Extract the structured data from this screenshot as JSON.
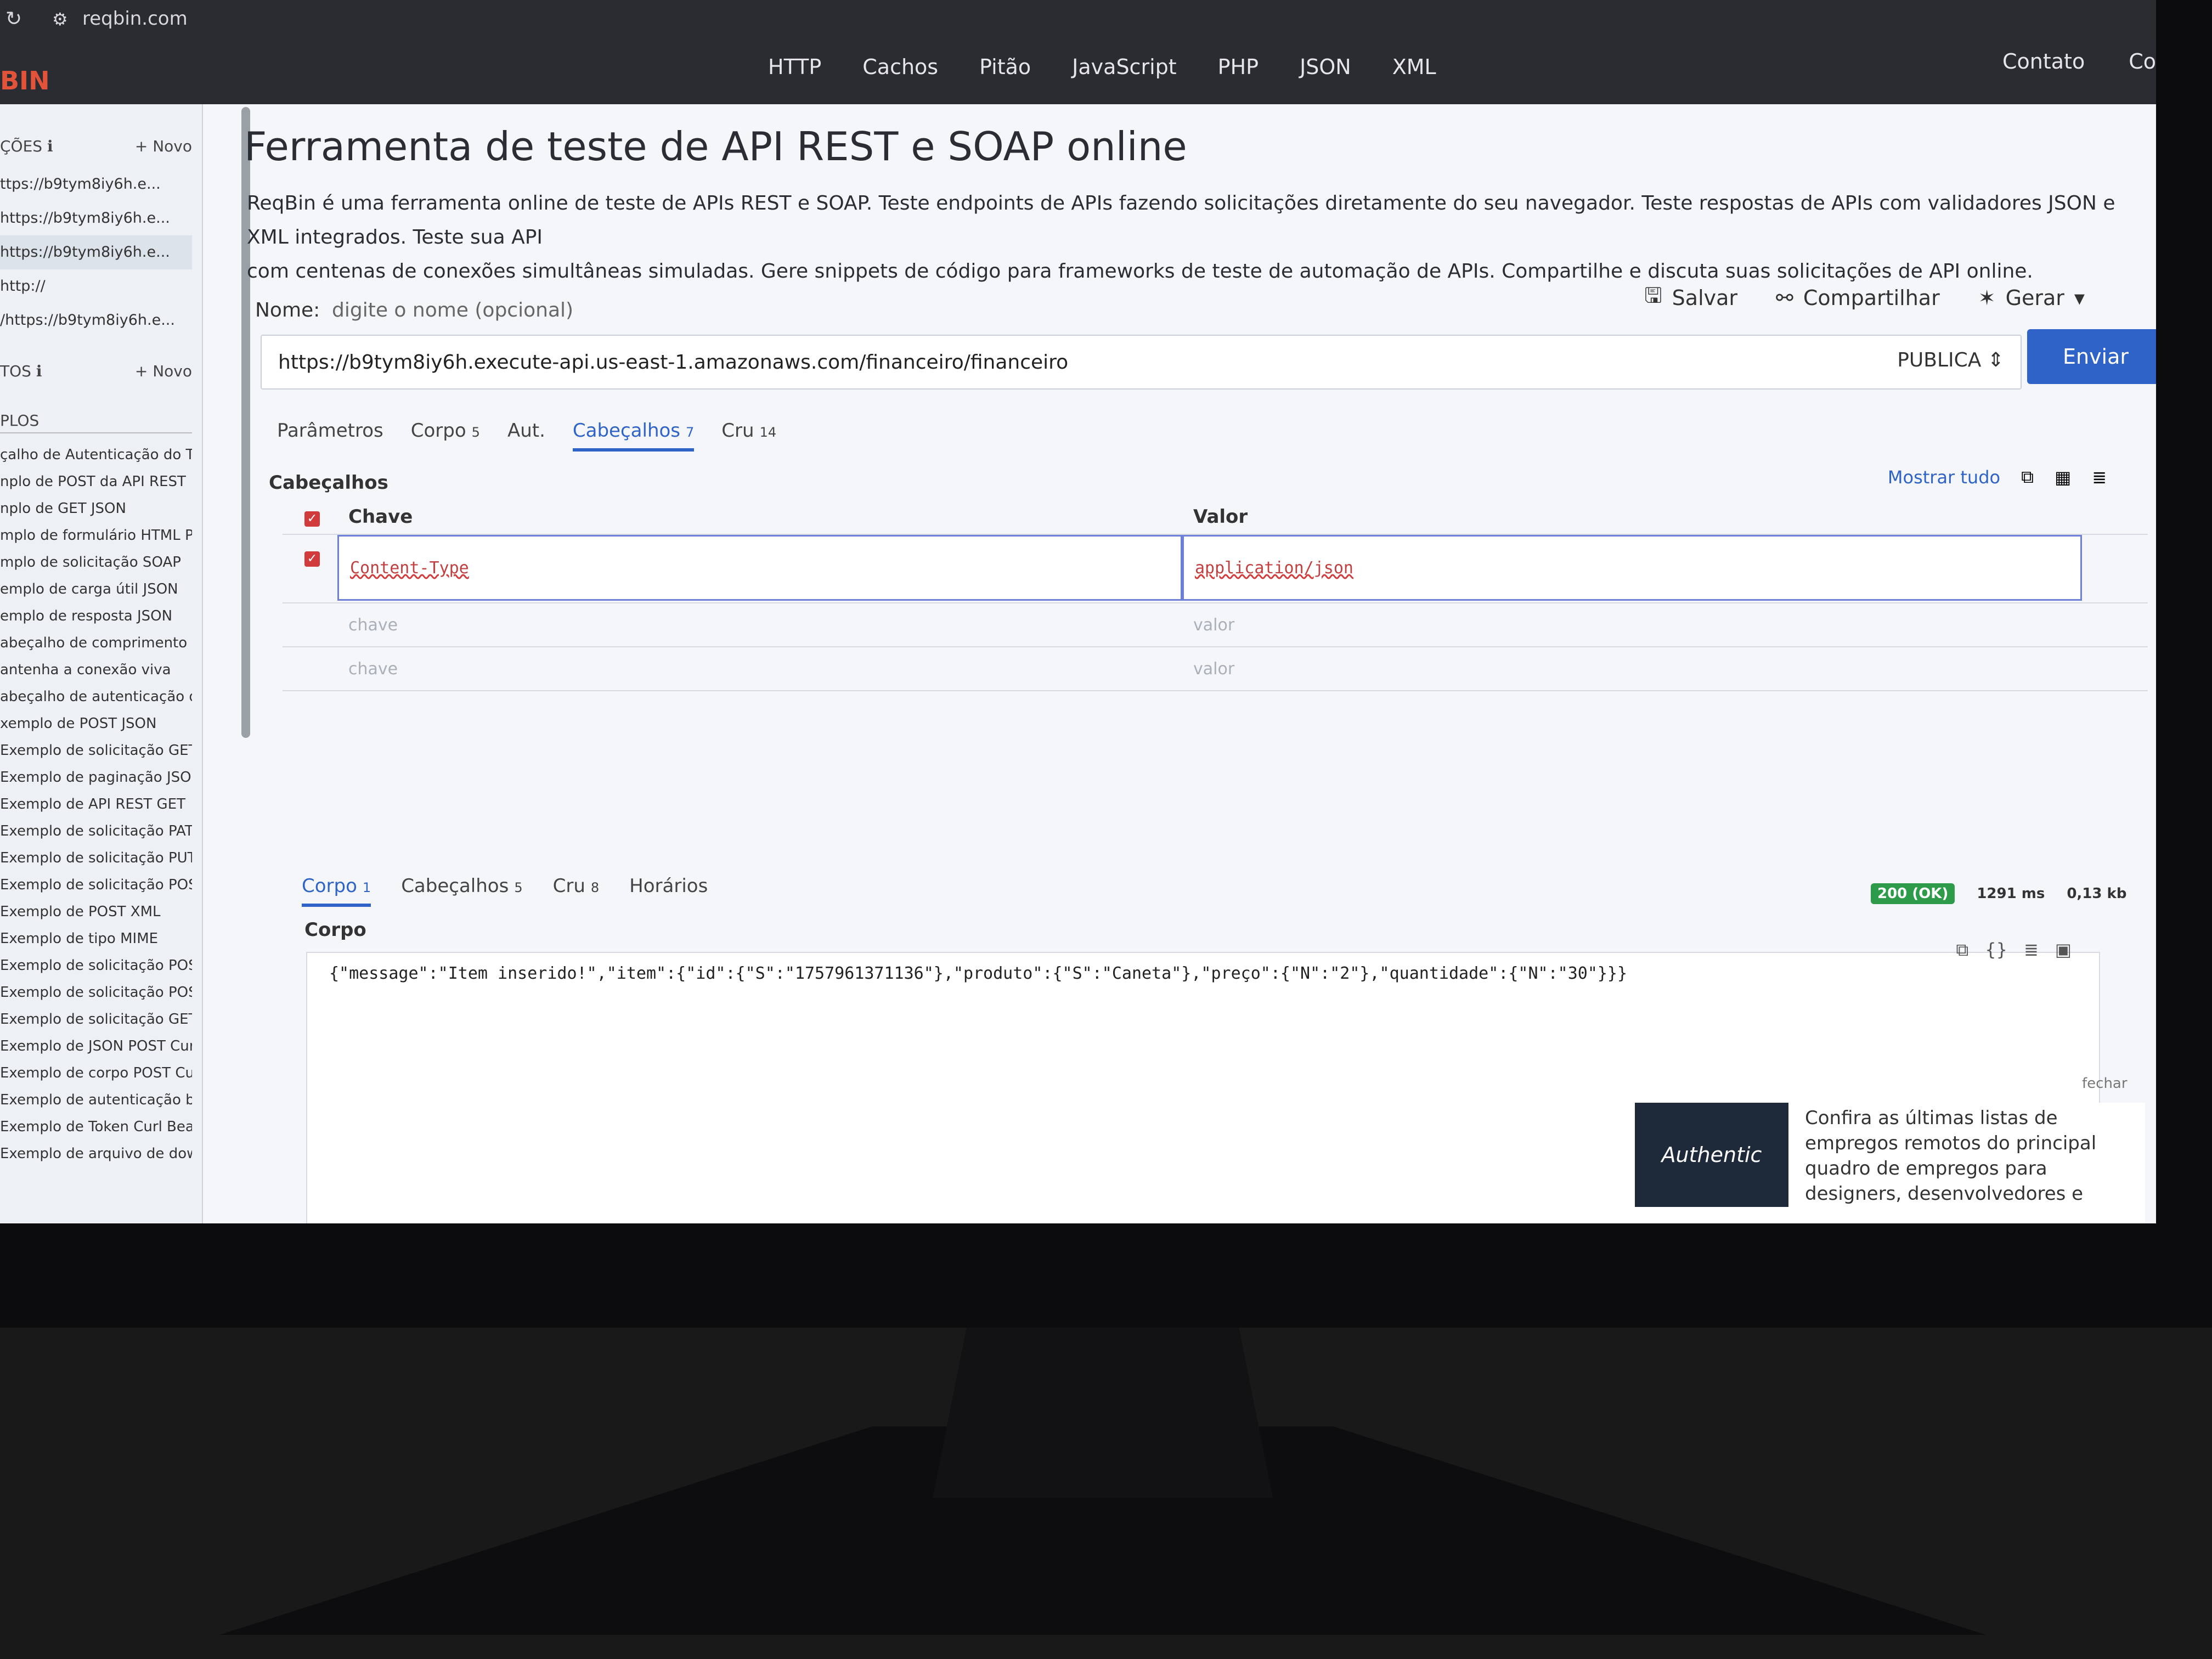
{
  "browser": {
    "url": "reqbin.com"
  },
  "nav": {
    "logo": "BIN",
    "links": [
      "HTTP",
      "Cachos",
      "Pitão",
      "JavaScript",
      "PHP",
      "JSON",
      "XML"
    ],
    "right": [
      "Contato",
      "Co"
    ]
  },
  "sidebar": {
    "collections_head": "ÇÕES ℹ",
    "new1": "+ Novo",
    "history": [
      "ttps://b9tym8iy6h.e...",
      "https://b9tym8iy6h.e...",
      "https://b9tym8iy6h.e...",
      "http://",
      "/https://b9tym8iy6h.e..."
    ],
    "saved_head": "TOS ℹ",
    "new2": "+ Novo",
    "examples_head": "PLOS",
    "examples": [
      "çalho de Autenticação do Toke",
      "nplo de POST da API REST",
      "nplo de GET JSON",
      "mplo de formulário HTML POST",
      "mplo de solicitação SOAP",
      "emplo de carga útil JSON",
      "emplo de resposta JSON",
      "abeçalho de comprimento de con",
      "antenha a conexão viva",
      "abeçalho de autenticação do toke",
      "xemplo de POST JSON",
      "Exemplo de solicitação GET",
      "Exemplo de paginação JSON",
      "Exemplo de API REST GET",
      "Exemplo de solicitação PATCH",
      "Exemplo de solicitação PUT",
      "Exemplo de solicitação POST",
      "Exemplo de POST XML",
      "Exemplo de tipo MIME",
      "Exemplo de solicitação POST da AP",
      "Exemplo de solicitação POST Curl",
      "Exemplo de solicitação GET Curl",
      "Exemplo de JSON POST Curl",
      "Exemplo de corpo POST Curl",
      "Exemplo de autenticação básica Cu",
      "Exemplo de Token Curl Bearer",
      "Exemplo de arquivo de download d"
    ]
  },
  "page": {
    "title": "Ferramenta de teste de API REST e SOAP online",
    "desc1": "ReqBin é uma ferramenta online de teste de APIs REST e SOAP. Teste endpoints de APIs fazendo solicitações diretamente do seu navegador. Teste respostas de APIs com validadores JSON e XML integrados. Teste sua API",
    "desc2": "com centenas de conexões simultâneas simuladas. Gere snippets de código para frameworks de teste de automação de APIs. Compartilhe e discuta suas solicitações de API online."
  },
  "request": {
    "name_label": "Nome:",
    "name_placeholder": "digite o nome (opcional)",
    "save": "Salvar",
    "share": "Compartilhar",
    "generate": "Gerar",
    "url": "https://b9tym8iy6h.execute-api.us-east-1.amazonaws.com/financeiro/financeiro",
    "method": "PUBLICA ⇕",
    "send": "Enviar",
    "tabs": [
      {
        "label": "Parâmetros",
        "count": ""
      },
      {
        "label": "Corpo",
        "count": "5"
      },
      {
        "label": "Aut.",
        "count": ""
      },
      {
        "label": "Cabeçalhos",
        "count": "7"
      },
      {
        "label": "Cru",
        "count": "14"
      }
    ],
    "headers_title": "Cabeçalhos",
    "show_all": "Mostrar tudo",
    "col_key": "Chave",
    "col_value": "Valor",
    "header_key": "Content-Type",
    "header_value": "application/json",
    "key_placeholder": "chave",
    "value_placeholder": "valor"
  },
  "response": {
    "tabs": [
      {
        "label": "Corpo",
        "count": "1"
      },
      {
        "label": "Cabeçalhos",
        "count": "5"
      },
      {
        "label": "Cru",
        "count": "8"
      },
      {
        "label": "Horários",
        "count": ""
      }
    ],
    "status": "200 (OK)",
    "time": "1291 ms",
    "size": "0,13 kb",
    "body_title": "Corpo",
    "body": "{\"message\":\"Item inserido!\",\"item\":{\"id\":{\"S\":\"1757961371136\"},\"produto\":{\"S\":\"Caneta\"},\"preço\":{\"N\":\"2\"},\"quantidade\":{\"N\":\"30\"}}}",
    "close": "fechar"
  },
  "ad": {
    "brand": "Authentic",
    "text": "Confira as últimas listas de empregos remotos do principal quadro de empregos para designers, desenvolvedores e"
  },
  "colors": {
    "accent": "#2f63c7",
    "ok": "#2e9b4a",
    "logo": "#e2533a"
  }
}
